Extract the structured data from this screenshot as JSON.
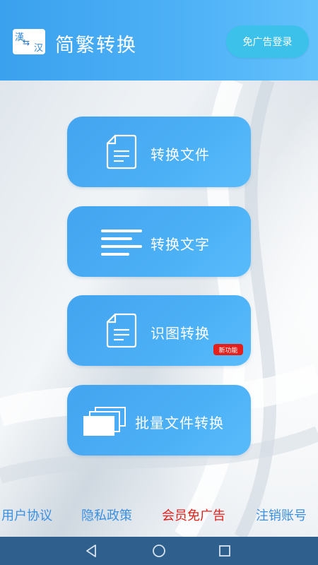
{
  "header": {
    "logo_top": "漢",
    "logo_bottom": "汉",
    "title": "简繁转换",
    "login_button": "免广告登录"
  },
  "cards": [
    {
      "label": "转换文件",
      "icon": "document-icon"
    },
    {
      "label": "转换文字",
      "icon": "text-lines-icon"
    },
    {
      "label": "识图转换",
      "icon": "document-icon",
      "badge": "新功能"
    },
    {
      "label": "批量文件转换",
      "icon": "stacked-files-icon"
    }
  ],
  "footer": {
    "user_agreement": "用户协议",
    "privacy_policy": "隐私政策",
    "vip_no_ads": "会员免广告",
    "delete_account": "注销账号"
  },
  "colors": {
    "accent": "#4aacf4",
    "link": "#3a8fe0",
    "vip_link": "#e3201b",
    "badge": "#e3201b",
    "navbar": "#2f5f8c"
  },
  "nav": [
    "back-icon",
    "home-icon",
    "recents-icon"
  ]
}
